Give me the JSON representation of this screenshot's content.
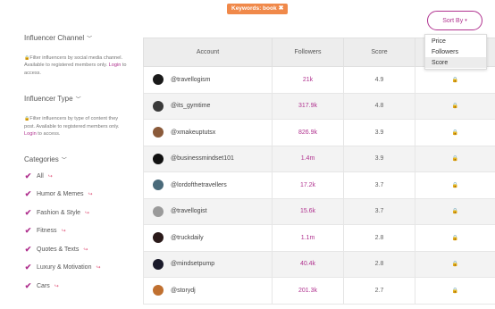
{
  "filter_pill": {
    "label": "Keywords: book",
    "close_glyph": "✖"
  },
  "sort": {
    "label": "Sort By",
    "options": [
      "Price",
      "Followers",
      "Score"
    ],
    "selected": "Score"
  },
  "sidebar": {
    "channel": {
      "title": "Influencer Channel",
      "note_pre": "Filter influencers by social media channel. Available to registered members only. ",
      "login": "Login",
      "note_post": " to access."
    },
    "type": {
      "title": "Influencer Type",
      "note_pre": "Filter influencers by type of content they post. Available to registered members only. ",
      "login": "Login",
      "note_post": " to access."
    },
    "categories": {
      "title": "Categories",
      "items": [
        {
          "label": "All"
        },
        {
          "label": "Humor & Memes"
        },
        {
          "label": "Fashion & Style"
        },
        {
          "label": "Fitness"
        },
        {
          "label": "Quotes & Texts"
        },
        {
          "label": "Luxury & Motivation"
        },
        {
          "label": "Cars"
        }
      ]
    }
  },
  "table": {
    "headers": [
      "Account",
      "Followers",
      "Score",
      ""
    ],
    "rows": [
      {
        "account": "@travellogism",
        "followers": "21k",
        "score": "4.9",
        "avatar_color": "#1a1a1a"
      },
      {
        "account": "@its_gymtime",
        "followers": "317.9k",
        "score": "4.8",
        "avatar_color": "#3a3a3a"
      },
      {
        "account": "@xmakeuptutsx",
        "followers": "826.9k",
        "score": "3.9",
        "avatar_color": "#8a5a3a"
      },
      {
        "account": "@businessmindset101",
        "followers": "1.4m",
        "score": "3.9",
        "avatar_color": "#111111"
      },
      {
        "account": "@lordofthetravellers",
        "followers": "17.2k",
        "score": "3.7",
        "avatar_color": "#4a6a7a"
      },
      {
        "account": "@travellogist",
        "followers": "15.6k",
        "score": "3.7",
        "avatar_color": "#9a9a9a"
      },
      {
        "account": "@truckdaily",
        "followers": "1.1m",
        "score": "2.8",
        "avatar_color": "#2a1a1a"
      },
      {
        "account": "@mindsetpump",
        "followers": "40.4k",
        "score": "2.8",
        "avatar_color": "#1a1a2a"
      },
      {
        "account": "@storydj",
        "followers": "201.3k",
        "score": "2.7",
        "avatar_color": "#c07030"
      }
    ]
  },
  "colors": {
    "accent": "#b0328f",
    "pill": "#f0894a"
  }
}
